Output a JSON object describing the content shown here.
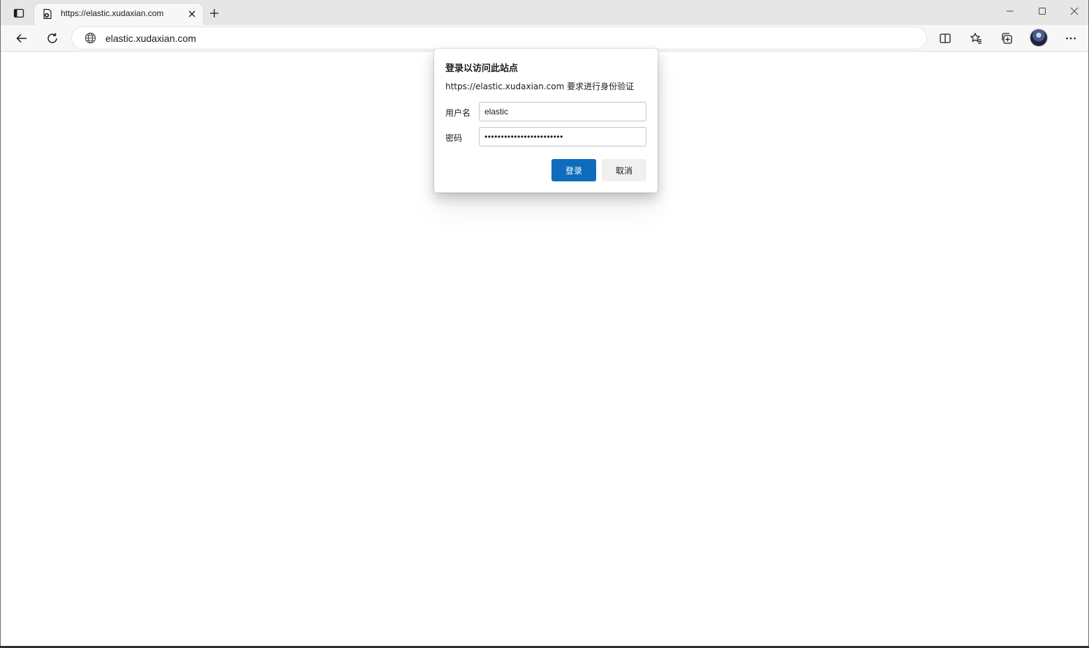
{
  "browser": {
    "tab": {
      "title": "https://elastic.xudaxian.com"
    },
    "address_bar": {
      "value": "elastic.xudaxian.com"
    },
    "icons": {
      "tab_actions": "tab-actions-icon",
      "favicon": "site-favicon-icon",
      "tab_close": "close-icon",
      "new_tab": "plus-icon",
      "minimize": "minimize-icon",
      "maximize": "maximize-icon",
      "window_close": "close-icon",
      "back": "back-arrow-icon",
      "refresh": "refresh-icon",
      "site_info": "globe-icon",
      "split_screen": "split-screen-icon",
      "favorites": "favorites-icon",
      "collections": "collections-icon",
      "more": "more-icon"
    }
  },
  "auth_dialog": {
    "title": "登录以访问此站点",
    "description": "https://elastic.xudaxian.com 要求进行身份验证",
    "username_label": "用户名",
    "username_value": "elastic",
    "password_label": "密码",
    "password_value": "••••••••••••••••••••••••",
    "submit_label": "登录",
    "cancel_label": "取消"
  },
  "colors": {
    "primary_button": "#0f6cbd",
    "titlebar": "#e6e6e6",
    "toolbar": "#f7f7f7"
  }
}
